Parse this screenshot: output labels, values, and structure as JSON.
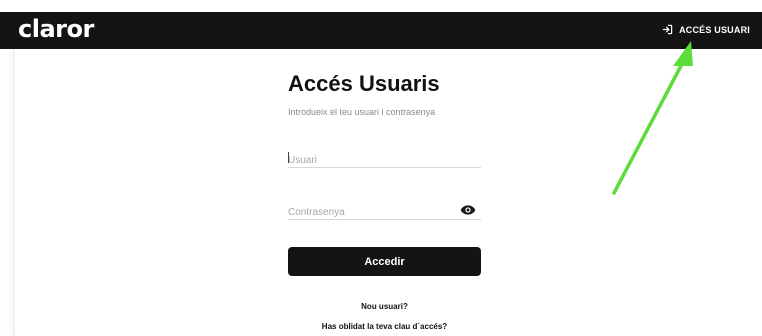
{
  "header": {
    "logo": "claror",
    "login_link": "ACCÉS USUARI",
    "login_icon": "login-icon"
  },
  "form": {
    "title": "Accés Usuaris",
    "subtitle": "Introdueix el teu usuari i contrasenya",
    "username": {
      "value": "",
      "placeholder": "Usuari"
    },
    "password": {
      "value": "",
      "placeholder": "Contrasenya",
      "toggle_icon": "eye-icon"
    },
    "submit_label": "Accedir",
    "new_user_link": "Nou usuari?",
    "forgot_link": "Has oblidat la teva clau d´accés?"
  },
  "annotation": {
    "arrow_color": "#5cdc3c"
  },
  "colors": {
    "header_bg": "#141414",
    "button_bg": "#141414",
    "text": "#111111",
    "muted_text": "#8a8a8a"
  }
}
